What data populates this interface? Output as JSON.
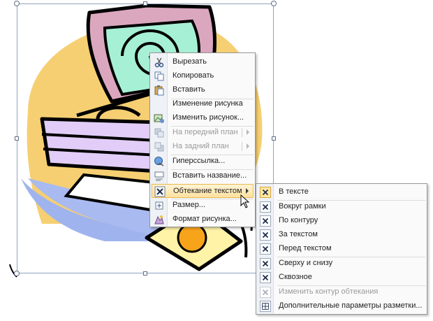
{
  "context_menu": {
    "items": [
      {
        "label": "Вырезать",
        "icon": "scissors-icon",
        "enabled": true
      },
      {
        "label": "Копировать",
        "icon": "copy-icon",
        "enabled": true
      },
      {
        "label": "Вставить",
        "icon": "paste-icon",
        "enabled": true
      },
      {
        "label": "Изменение рисунка",
        "icon": "",
        "enabled": true
      },
      {
        "label": "Изменить рисунок...",
        "icon": "change-picture-icon",
        "enabled": true
      },
      {
        "label": "На передний план",
        "icon": "bring-forward-icon",
        "enabled": false,
        "submenu": true
      },
      {
        "label": "На задний план",
        "icon": "send-backward-icon",
        "enabled": false,
        "submenu": true
      },
      {
        "label": "Гиперссылка...",
        "icon": "hyperlink-icon",
        "enabled": true
      },
      {
        "label": "Вставить название...",
        "icon": "insert-caption-icon",
        "enabled": true
      },
      {
        "label": "Обтекание текстом",
        "icon": "text-wrap-icon",
        "enabled": true,
        "submenu": true,
        "highlighted": true
      },
      {
        "label": "Размер...",
        "icon": "size-icon",
        "enabled": true
      },
      {
        "label": "Формат рисунка...",
        "icon": "format-picture-icon",
        "enabled": true
      }
    ]
  },
  "wrap_submenu": {
    "items": [
      {
        "label": "В тексте",
        "icon": "wrap-inline-icon",
        "enabled": true,
        "checked": true
      },
      {
        "label": "Вокруг рамки",
        "icon": "wrap-square-icon",
        "enabled": true
      },
      {
        "label": "По контуру",
        "icon": "wrap-tight-icon",
        "enabled": true
      },
      {
        "label": "За текстом",
        "icon": "wrap-behind-icon",
        "enabled": true
      },
      {
        "label": "Перед текстом",
        "icon": "wrap-front-icon",
        "enabled": true
      },
      {
        "label": "Сверху и снизу",
        "icon": "wrap-top-bottom-icon",
        "enabled": true
      },
      {
        "label": "Сквозное",
        "icon": "wrap-through-icon",
        "enabled": true
      },
      {
        "label": "Изменить контур обтекания",
        "icon": "edit-wrap-points-icon",
        "enabled": false
      },
      {
        "label": "Дополнительные параметры разметки...",
        "icon": "more-layout-options-icon",
        "enabled": true
      }
    ]
  },
  "colors": {
    "highlight_fill": "#ffe2a0",
    "highlight_border": "#e8b94e",
    "menu_gutter": "#eef1f6"
  }
}
